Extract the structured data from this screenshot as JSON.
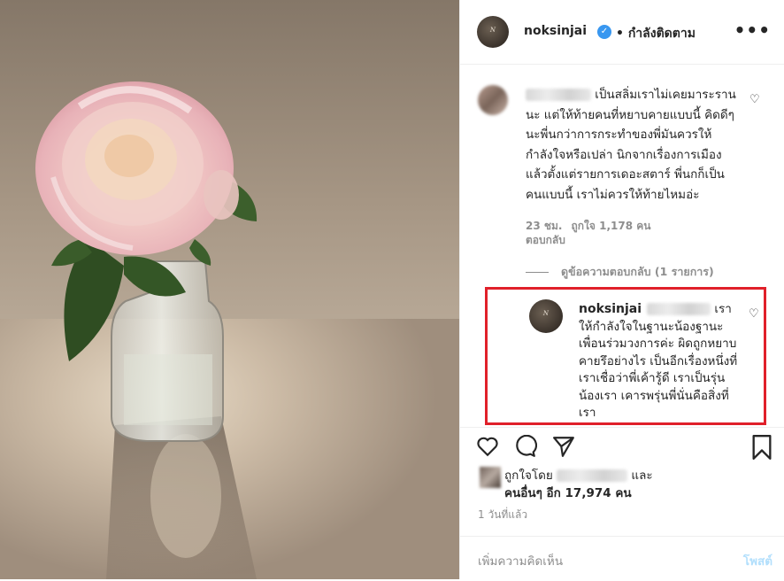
{
  "header": {
    "username": "noksinjai",
    "verified_icon": "verified-badge-icon",
    "follow_status": "• กำลังติดตาม",
    "more_icon": "•••"
  },
  "comment": {
    "text": "เป็นสลิ่มเราไม่เคยมาระรานนะ แต่ให้ท้ายคนที่หยาบคายแบบนี้ คิดดีๆนะพี่นกว่าการกระทำของพี่มันควรให้กำลังใจหรือเปล่า นิกจากเรื่องการเมืองแล้วตั้งแต่รายการเดอะสตาร์ พี่นกก็เป็นคนแบบนี้ เราไม่ควรให้ท้ายไหมอ่ะ",
    "time": "23 ชม.",
    "likes": "ถูกใจ 1,178 คน",
    "reply_label": "ตอบกลับ",
    "view_replies": "ดูข้อความตอบกลับ (1 รายการ)"
  },
  "reply": {
    "username": "noksinjai",
    "text": "เราให้กำลังใจในฐานะน้องฐานะเพื่อนร่วมวงการค่ะ ผิดถูกหยาบคายรึอย่างไร เป็นอีกเรื่องหนึ่งที่เราเชื่อว่าพี่เค้ารู้ดี เราเป็นรุ่นน้องเรา เคารพรุ่นพี่นั่นคือสิ่งที่เรา"
  },
  "actions": {
    "like_icon": "heart-icon",
    "comment_icon": "comment-bubble-icon",
    "share_icon": "paper-plane-icon",
    "save_icon": "bookmark-icon"
  },
  "likes": {
    "prefix": "ถูกใจโดย",
    "and": "และ",
    "others": "คนอื่นๆ อีก 17,974 คน"
  },
  "post_time": "1 วันที่แล้ว",
  "composer": {
    "placeholder": "เพิ่มความคิดเห็น",
    "post_label": "โพสต์"
  },
  "colors": {
    "highlight_border": "#e0202a",
    "verified": "#3897f0",
    "post_disabled": "#b2dffc"
  }
}
